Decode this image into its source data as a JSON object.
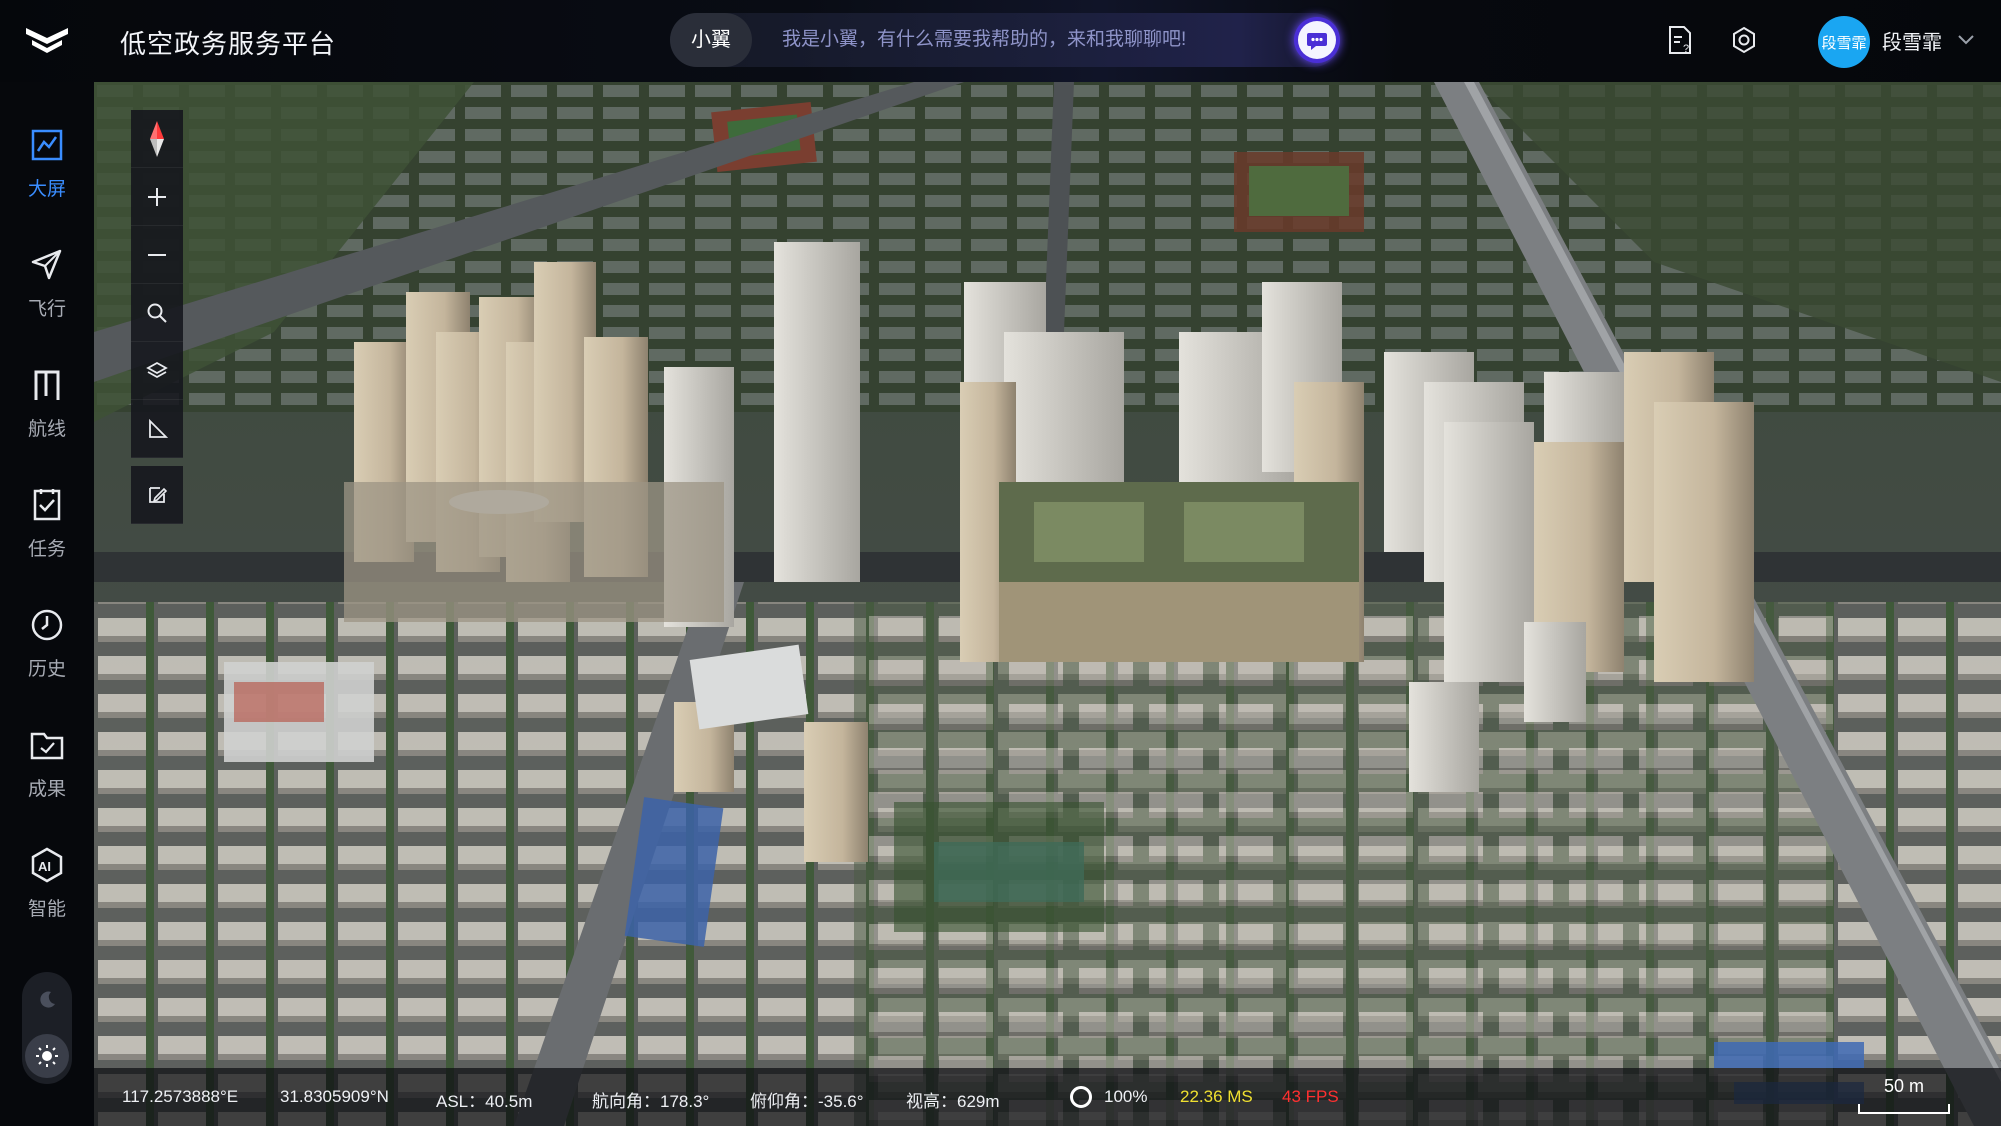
{
  "header": {
    "app_title": "低空政务服务平台",
    "assistant_name": "小翼",
    "assistant_prompt": "我是小翼，有什么需要我帮助的，来和我聊聊吧!",
    "user_avatar_text": "段雪霏",
    "user_name": "段雪霏"
  },
  "sidebar": {
    "items": [
      {
        "label": "大屏",
        "icon": "dashboard-chart-icon",
        "active": true
      },
      {
        "label": "飞行",
        "icon": "paper-plane-icon",
        "active": false
      },
      {
        "label": "航线",
        "icon": "route-icon",
        "active": false
      },
      {
        "label": "任务",
        "icon": "task-check-icon",
        "active": false
      },
      {
        "label": "历史",
        "icon": "clock-icon",
        "active": false
      },
      {
        "label": "成果",
        "icon": "folder-result-icon",
        "active": false
      },
      {
        "label": "智能",
        "icon": "ai-badge-icon",
        "active": false
      }
    ],
    "theme_modes": [
      "moon-icon",
      "sun-icon"
    ],
    "active_theme": "sun-icon"
  },
  "map_tools": [
    "compass-icon",
    "zoom-in-icon",
    "zoom-out-icon",
    "search-icon",
    "layers-icon",
    "measure-angle-icon",
    "edit-icon"
  ],
  "status": {
    "longitude": "117.2573888°E",
    "latitude": "31.8305909°N",
    "asl": "ASL：40.5m",
    "heading": "航向角：178.3°",
    "pitch": "俯仰角：-35.6°",
    "view_height": "视高：629m",
    "load_percent": "100%",
    "frame_ms": "22.36 MS",
    "fps": "43 FPS",
    "scale": "50 m"
  },
  "colors": {
    "accent": "#3a8dff",
    "ms_color": "#f0e030",
    "fps_color": "#ff3030",
    "assistant_button": "#4a2fd6"
  }
}
